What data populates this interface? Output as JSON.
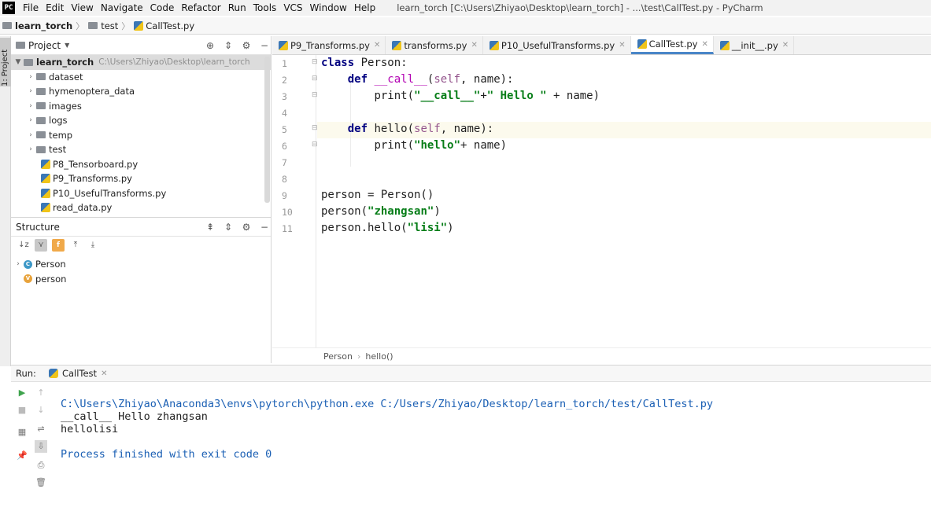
{
  "menubar": {
    "items": [
      "File",
      "Edit",
      "View",
      "Navigate",
      "Code",
      "Refactor",
      "Run",
      "Tools",
      "VCS",
      "Window",
      "Help"
    ],
    "window_title": "learn_torch [C:\\Users\\Zhiyao\\Desktop\\learn_torch] - ...\\test\\CallTest.py - PyCharm"
  },
  "navbar": {
    "crumbs": [
      "learn_torch",
      "test",
      "CallTest.py"
    ]
  },
  "side_strip": {
    "tab_label": "1: Project"
  },
  "project": {
    "title": "Project",
    "root": {
      "name": "learn_torch",
      "path": "C:\\Users\\Zhiyao\\Desktop\\learn_torch"
    },
    "folders": [
      "dataset",
      "hymenoptera_data",
      "images",
      "logs",
      "temp",
      "test"
    ],
    "files": [
      "P8_Tensorboard.py",
      "P9_Transforms.py",
      "P10_UsefulTransforms.py",
      "read_data.py"
    ]
  },
  "structure": {
    "title": "Structure",
    "items": [
      {
        "kind": "class",
        "name": "Person",
        "icon": "C"
      },
      {
        "kind": "variable",
        "name": "person",
        "icon": "V"
      }
    ]
  },
  "tabs": [
    {
      "label": "P9_Transforms.py",
      "active": false
    },
    {
      "label": "transforms.py",
      "active": false
    },
    {
      "label": "P10_UsefulTransforms.py",
      "active": false
    },
    {
      "label": "CallTest.py",
      "active": true
    },
    {
      "label": "__init__.py",
      "active": false
    }
  ],
  "editor": {
    "line_numbers": [
      "1",
      "2",
      "3",
      "4",
      "5",
      "6",
      "7",
      "8",
      "9",
      "10",
      "11"
    ],
    "tokens": {
      "l1_kw": "class",
      "l1_rest": " Person:",
      "l2_kw": "def",
      "l2_name": "__call__",
      "l2_open": "(",
      "l2_self": "self",
      "l2_rest": ", name):",
      "l3_print": "print(",
      "l3_s1": "\"__call__\"",
      "l3_plus": "+",
      "l3_s2": "\" Hello \"",
      "l3_rest": " + name)",
      "l5_kw": "def",
      "l5_name": " hello",
      "l5_open": "(",
      "l5_self": "self",
      "l5_rest": ", name):",
      "l6_print": "print(",
      "l6_s1": "\"hello\"",
      "l6_rest": "+ name)",
      "l9": "person = Person()",
      "l10_call": "person(",
      "l10_s": "\"zhangsan\"",
      "l10_close": ")",
      "l11_call": "person.hello(",
      "l11_s": "\"lisi\"",
      "l11_close": ")"
    }
  },
  "code_breadcrumb": [
    "Person",
    "hello()"
  ],
  "run": {
    "label": "Run:",
    "tab": "CallTest",
    "output": [
      "C:\\Users\\Zhiyao\\Anaconda3\\envs\\pytorch\\python.exe C:/Users/Zhiyao/Desktop/learn_torch/test/CallTest.py",
      "__call__ Hello zhangsan",
      "hellolisi",
      "",
      "Process finished with exit code 0"
    ]
  }
}
